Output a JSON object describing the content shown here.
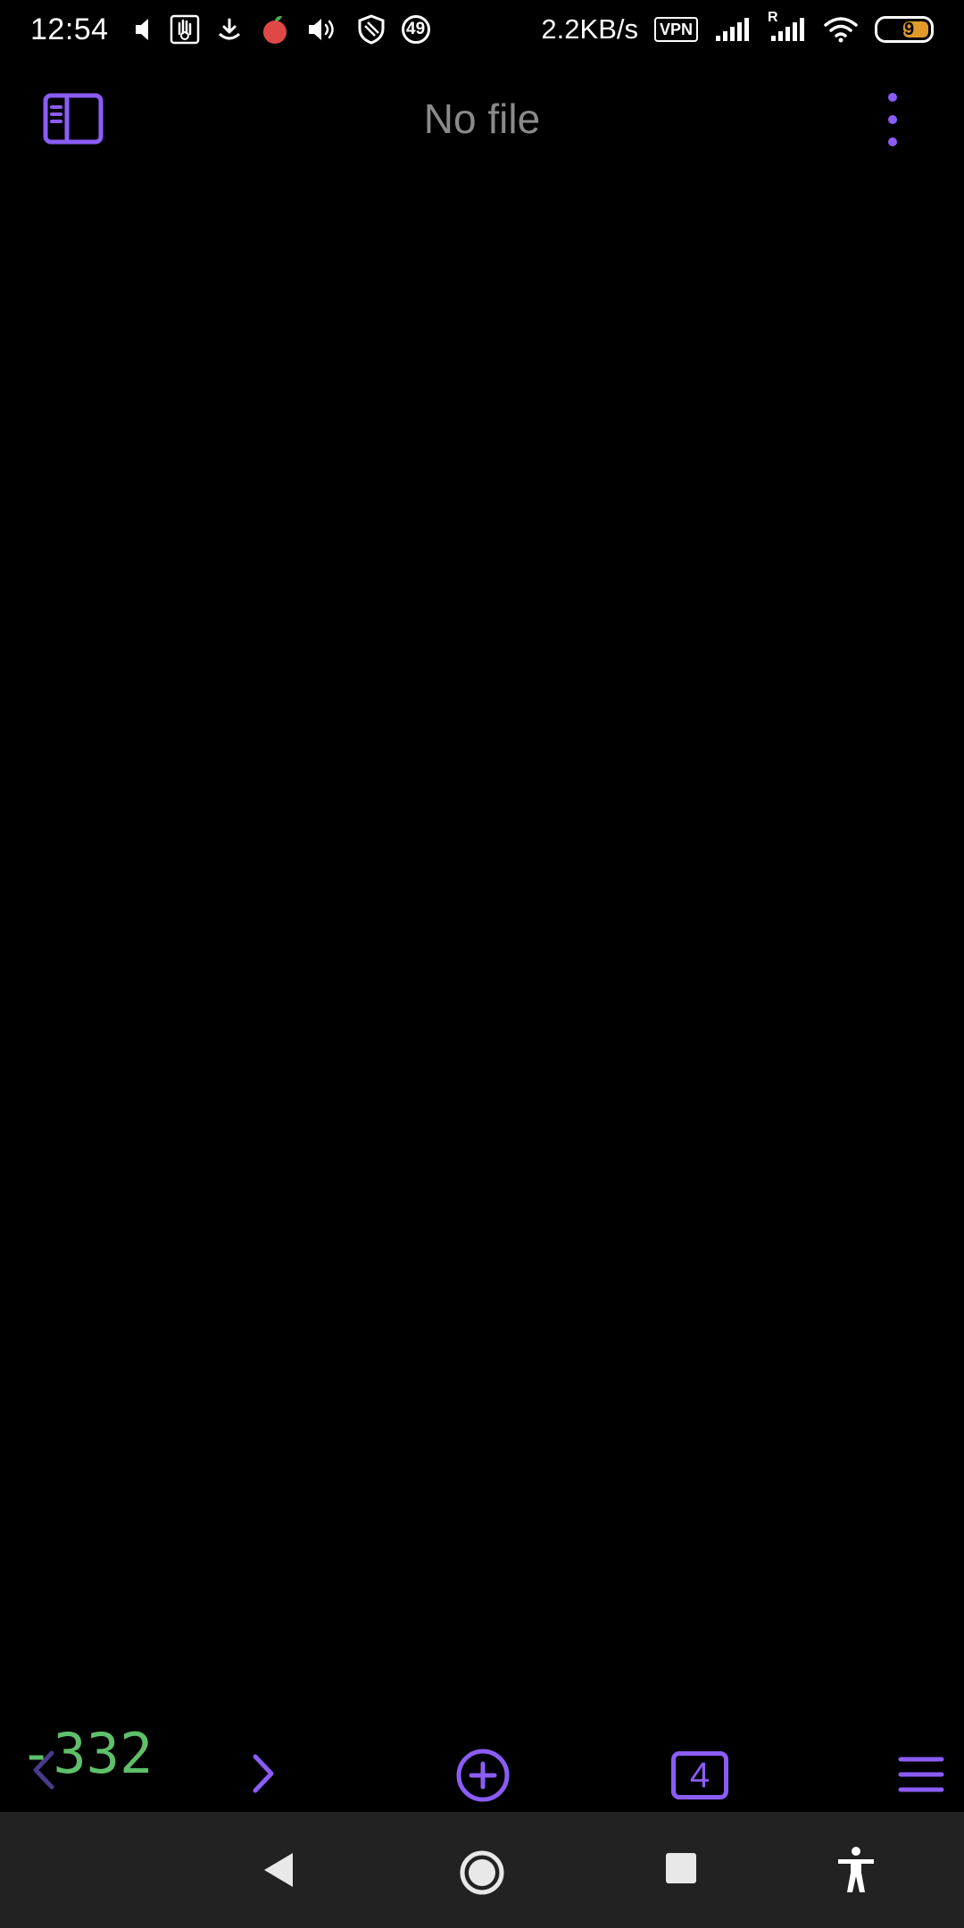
{
  "status_bar": {
    "time": "12:54",
    "notification_badge": "49",
    "net_speed": "2.2KB/s",
    "vpn_label": "VPN",
    "roaming_label": "R",
    "battery_level": "49",
    "battery_color": "#e09a2a"
  },
  "app_bar": {
    "title": "No file",
    "accent_color": "#8b5cf6"
  },
  "bottom_toolbar": {
    "overlay_number": "-332",
    "overlay_color": "#5fbf6a",
    "tab_count": "4"
  },
  "icons": {
    "sidebar_toggle": "sidebar-toggle-icon",
    "more_menu": "more-vertical-icon",
    "back": "chevron-left-icon",
    "forward": "chevron-right-icon",
    "new_file": "plus-circle-icon",
    "menu": "hamburger-menu-icon",
    "nav_back": "triangle-back-icon",
    "nav_home": "circle-home-icon",
    "nav_recents": "square-recents-icon",
    "accessibility": "accessibility-icon"
  }
}
